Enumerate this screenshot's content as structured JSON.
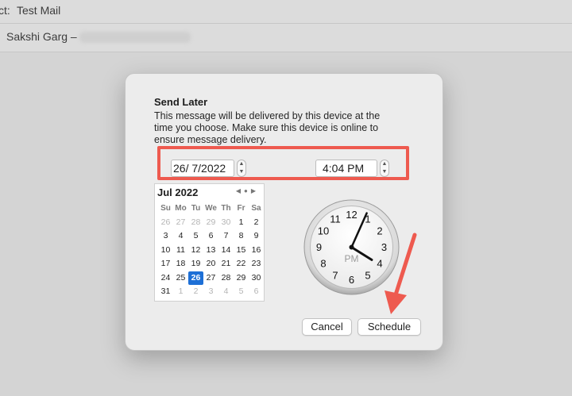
{
  "mail": {
    "subject_label": "ct:",
    "subject_value": "Test Mail",
    "from_value": "Sakshi Garg –"
  },
  "dialog": {
    "title": "Send Later",
    "description": "This message will be delivered by this device at the time you choose. Make sure this device is online to ensure message delivery.",
    "date_value": "26/  7/2022",
    "time_value": "4:04 PM",
    "cancel_label": "Cancel",
    "schedule_label": "Schedule"
  },
  "calendar": {
    "month_label": "Jul 2022",
    "weekdays": [
      "Su",
      "Mo",
      "Tu",
      "We",
      "Th",
      "Fr",
      "Sa"
    ],
    "days": [
      [
        "26",
        "m"
      ],
      [
        "27",
        "m"
      ],
      [
        "28",
        "m"
      ],
      [
        "29",
        "m"
      ],
      [
        "30",
        "m"
      ],
      [
        "1",
        ""
      ],
      [
        "2",
        ""
      ],
      [
        "3",
        ""
      ],
      [
        "4",
        ""
      ],
      [
        "5",
        ""
      ],
      [
        "6",
        ""
      ],
      [
        "7",
        ""
      ],
      [
        "8",
        ""
      ],
      [
        "9",
        ""
      ],
      [
        "10",
        ""
      ],
      [
        "11",
        ""
      ],
      [
        "12",
        ""
      ],
      [
        "13",
        ""
      ],
      [
        "14",
        ""
      ],
      [
        "15",
        ""
      ],
      [
        "16",
        ""
      ],
      [
        "17",
        ""
      ],
      [
        "18",
        ""
      ],
      [
        "19",
        ""
      ],
      [
        "20",
        ""
      ],
      [
        "21",
        ""
      ],
      [
        "22",
        ""
      ],
      [
        "23",
        ""
      ],
      [
        "24",
        ""
      ],
      [
        "25",
        ""
      ],
      [
        "26",
        "s"
      ],
      [
        "27",
        ""
      ],
      [
        "28",
        ""
      ],
      [
        "29",
        ""
      ],
      [
        "30",
        ""
      ],
      [
        "31",
        ""
      ],
      [
        "1",
        "m"
      ],
      [
        "2",
        "m"
      ],
      [
        "3",
        "m"
      ],
      [
        "4",
        "m"
      ],
      [
        "5",
        "m"
      ],
      [
        "6",
        "m"
      ]
    ]
  },
  "clock": {
    "numbers": [
      "12",
      "1",
      "2",
      "3",
      "4",
      "5",
      "6",
      "7",
      "8",
      "9",
      "10",
      "11"
    ],
    "period": "PM",
    "hour": 4,
    "minute": 4
  },
  "colors": {
    "highlight": "#ee5a4f",
    "selected_day": "#1d6fd6"
  }
}
